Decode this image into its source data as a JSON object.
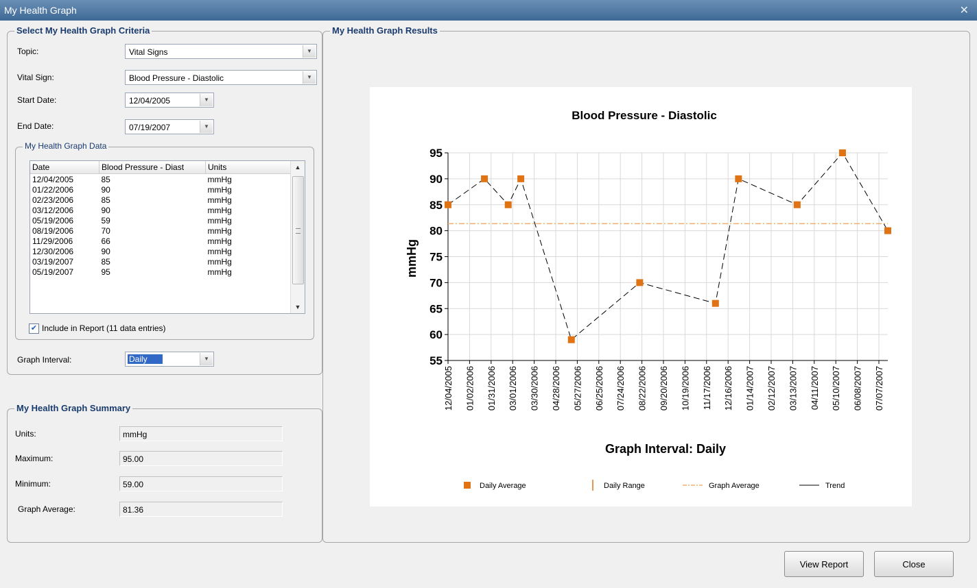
{
  "window": {
    "title": "My Health Graph",
    "close_glyph": "✕"
  },
  "criteria": {
    "legend": "Select My Health Graph Criteria",
    "topic_label": "Topic:",
    "topic_value": "Vital Signs",
    "vital_label": "Vital Sign:",
    "vital_value": "Blood Pressure - Diastolic",
    "start_label": "Start Date:",
    "start_value": "12/04/2005",
    "end_label": "End Date:",
    "end_value": "07/19/2007",
    "data_legend": "My Health Graph Data",
    "columns": [
      "Date",
      "Blood Pressure - Diast",
      "Units"
    ],
    "rows": [
      [
        "12/04/2005",
        "85",
        "mmHg"
      ],
      [
        "01/22/2006",
        "90",
        "mmHg"
      ],
      [
        "02/23/2006",
        "85",
        "mmHg"
      ],
      [
        "03/12/2006",
        "90",
        "mmHg"
      ],
      [
        "05/19/2006",
        "59",
        "mmHg"
      ],
      [
        "08/19/2006",
        "70",
        "mmHg"
      ],
      [
        "11/29/2006",
        "66",
        "mmHg"
      ],
      [
        "12/30/2006",
        "90",
        "mmHg"
      ],
      [
        "03/19/2007",
        "85",
        "mmHg"
      ],
      [
        "05/19/2007",
        "95",
        "mmHg"
      ]
    ],
    "include_label": "Include in Report (11 data entries)",
    "include_checked": true,
    "interval_label": "Graph Interval:",
    "interval_value": "Daily"
  },
  "summary": {
    "legend": "My Health Graph Summary",
    "units_label": "Units:",
    "units_value": "mmHg",
    "max_label": "Maximum:",
    "max_value": "95.00",
    "min_label": "Minimum:",
    "min_value": "59.00",
    "avg_label": "Graph Average:",
    "avg_value": "81.36"
  },
  "results": {
    "legend": "My Health Graph Results"
  },
  "buttons": {
    "view_report": "View Report",
    "close": "Close"
  },
  "icons": {
    "dropdown": "chevron-down-icon",
    "check": "checkmark-icon"
  },
  "colors": {
    "marker": "#e07314",
    "average_line": "#f0b070",
    "trend": "#000000",
    "title_bar": "#3d6996"
  },
  "chart_data": {
    "type": "line",
    "title": "Blood Pressure - Diastolic",
    "xlabel": "Graph Interval: Daily",
    "ylabel": "mmHg",
    "ylim": [
      55,
      95
    ],
    "yticks": [
      55,
      60,
      65,
      70,
      75,
      80,
      85,
      90,
      95
    ],
    "x_tick_labels": [
      "12/04/2005",
      "01/02/2006",
      "01/31/2006",
      "03/01/2006",
      "03/30/2006",
      "04/28/2006",
      "05/27/2006",
      "06/25/2006",
      "07/24/2006",
      "08/22/2006",
      "09/20/2006",
      "10/19/2006",
      "11/17/2006",
      "12/16/2006",
      "01/14/2007",
      "02/12/2007",
      "03/13/2007",
      "04/11/2007",
      "05/10/2007",
      "06/08/2007",
      "07/07/2007"
    ],
    "x_range": [
      "12/04/2005",
      "07/19/2007"
    ],
    "series": [
      {
        "name": "Daily Average",
        "x": [
          "12/04/2005",
          "01/22/2006",
          "02/23/2006",
          "03/12/2006",
          "05/19/2006",
          "08/19/2006",
          "11/29/2006",
          "12/30/2006",
          "03/19/2007",
          "05/19/2007",
          "07/19/2007"
        ],
        "y": [
          85,
          90,
          85,
          90,
          59,
          70,
          66,
          90,
          85,
          95,
          80
        ]
      }
    ],
    "graph_average": 81.36,
    "legend_items": [
      "Daily Average",
      "Daily Range",
      "Graph Average",
      "Trend"
    ],
    "legend_position": "bottom",
    "grid": true
  }
}
